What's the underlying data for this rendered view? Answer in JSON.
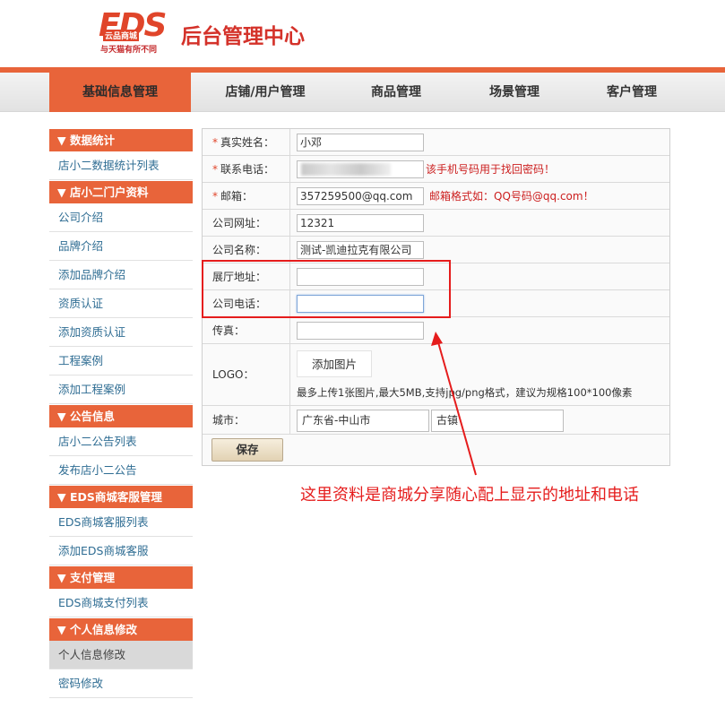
{
  "header": {
    "logo_mark": "EDS",
    "logo_sub": "云品商城",
    "logo_tagline": "与天猫有所不同",
    "title": "后台管理中心"
  },
  "nav": {
    "tabs": [
      "基础信息管理",
      "店铺/用户管理",
      "商品管理",
      "场景管理",
      "客户管理"
    ],
    "active_index": 0
  },
  "sidebar": {
    "sections": [
      {
        "title": "▼ 数据统计",
        "items": [
          "店小二数据统计列表"
        ]
      },
      {
        "title": "▼ 店小二门户资料",
        "items": [
          "公司介绍",
          "品牌介绍",
          "添加品牌介绍",
          "资质认证",
          "添加资质认证",
          "工程案例",
          "添加工程案例"
        ]
      },
      {
        "title": "▼ 公告信息",
        "items": [
          "店小二公告列表",
          "发布店小二公告"
        ]
      },
      {
        "title": "▼ EDS商城客服管理",
        "items": [
          "EDS商城客服列表",
          "添加EDS商城客服"
        ]
      },
      {
        "title": "▼ 支付管理",
        "items": [
          "EDS商城支付列表"
        ]
      },
      {
        "title": "▼ 个人信息修改",
        "items": [
          "个人信息修改",
          "密码修改"
        ]
      }
    ],
    "selected_item": "个人信息修改"
  },
  "form": {
    "required_mark": "*",
    "real_name": {
      "label": "真实姓名：",
      "value": "小邓"
    },
    "phone": {
      "label": "联系电话：",
      "value": "",
      "hint": "该手机号码用于找回密码！"
    },
    "email": {
      "label": "邮箱：",
      "value": "357259500@qq.com",
      "hint": "邮箱格式如：QQ号码@qq.com！"
    },
    "website": {
      "label": "公司网址：",
      "value": "12321"
    },
    "company_name": {
      "label": "公司名称：",
      "value": "测试-凯迪拉克有限公司"
    },
    "showroom_address": {
      "label": "展厅地址：",
      "value": ""
    },
    "company_phone": {
      "label": "公司电话：",
      "value": ""
    },
    "fax": {
      "label": "传真：",
      "value": ""
    },
    "logo": {
      "label": "LOGO：",
      "button": "添加图片",
      "tip": "最多上传1张图片,最大5MB,支持jpg/png格式，建议为规格100*100像素"
    },
    "city": {
      "label": "城市：",
      "province_city": "广东省-中山市",
      "town": "古镇"
    },
    "save_label": "保存"
  },
  "annotation": {
    "note": "这里资料是商城分享随心配上显示的地址和电话",
    "color": "#e51c1c"
  },
  "colors": {
    "accent": "#e8643a",
    "link": "#2f6d93",
    "hint": "#cc1f1f"
  }
}
